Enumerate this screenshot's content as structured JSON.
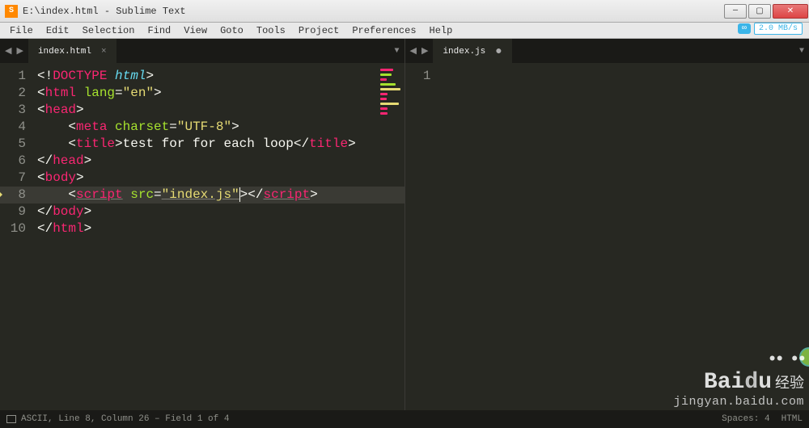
{
  "window": {
    "title": "E:\\index.html - Sublime Text",
    "app_icon_char": "S"
  },
  "menu": [
    "File",
    "Edit",
    "Selection",
    "Find",
    "View",
    "Goto",
    "Tools",
    "Project",
    "Preferences",
    "Help"
  ],
  "speed": {
    "icon": "∞",
    "rate": "2.0 MB/s"
  },
  "tabs": {
    "left": {
      "name": "index.html",
      "modified": false,
      "active": true
    },
    "right": {
      "name": "index.js",
      "modified": true,
      "active": true
    }
  },
  "editor_left": {
    "line_numbers": [
      "1",
      "2",
      "3",
      "4",
      "5",
      "6",
      "7",
      "8",
      "9",
      "10"
    ],
    "highlighted_line": 8,
    "code": {
      "doctype": {
        "open": "<!",
        "kw": "DOCTYPE",
        "arg": "html",
        "close": ">"
      },
      "html_open": {
        "tag": "html",
        "attr": "lang",
        "val": "\"en\""
      },
      "head_open": {
        "tag": "head"
      },
      "meta": {
        "tag": "meta",
        "attr": "charset",
        "val": "\"UTF-8\""
      },
      "title": {
        "tag": "title",
        "text": "test for for each loop"
      },
      "head_close": {
        "tag": "head"
      },
      "body_open": {
        "tag": "body"
      },
      "script": {
        "tag": "script",
        "attr": "src",
        "val": "\"index.js\""
      },
      "body_close": {
        "tag": "body"
      },
      "html_close": {
        "tag": "html"
      }
    }
  },
  "editor_right": {
    "line_numbers": [
      "1"
    ]
  },
  "statusbar": {
    "position": "ASCII, Line 8, Column 26 – Field 1 of 4",
    "spaces": "Spaces: 4",
    "syntax": "HTML"
  },
  "watermark": {
    "brand_left": "Bai",
    "brand_d": "d",
    "brand_right": "u",
    "cn": "经验",
    "url": "jingyan.baidu.com"
  }
}
